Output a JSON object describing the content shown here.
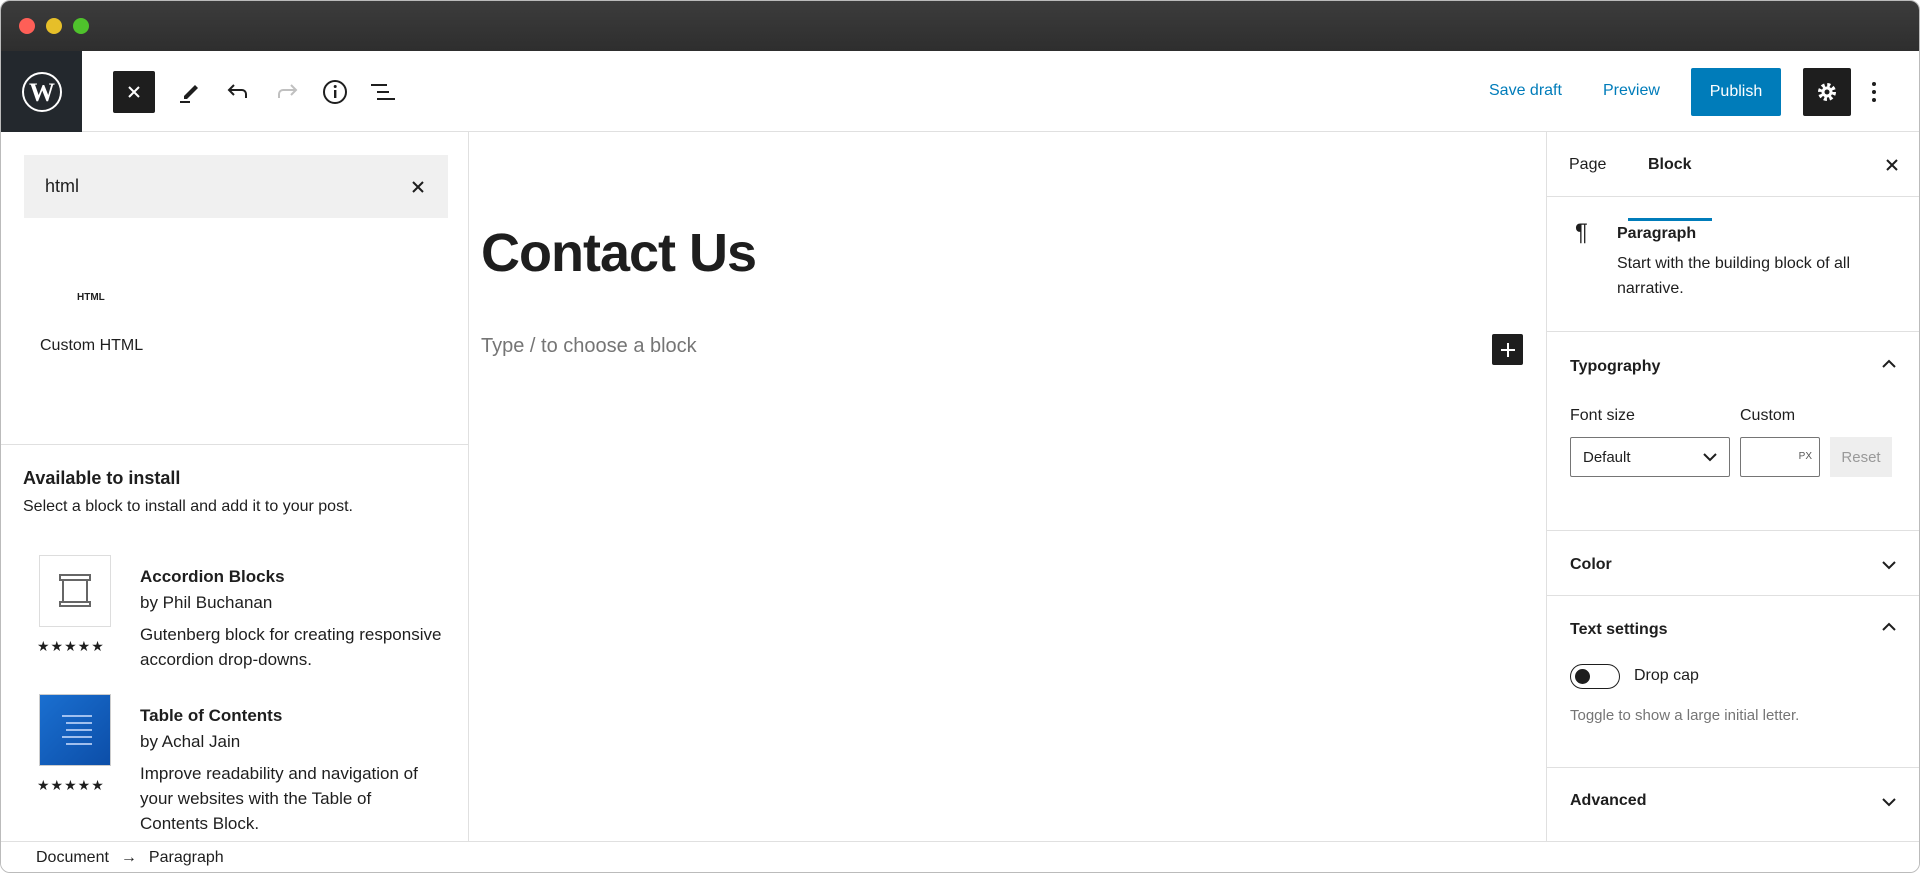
{
  "toolbar": {
    "save_draft": "Save draft",
    "preview": "Preview",
    "publish": "Publish"
  },
  "inserter": {
    "search_value": "html",
    "result_icon_text": "HTML",
    "result_label": "Custom HTML",
    "install_title": "Available to install",
    "install_desc": "Select a block to install and add it to your post.",
    "plugins": [
      {
        "title": "Accordion Blocks",
        "author": "by Phil Buchanan",
        "desc": "Gutenberg block for creating responsive accordion drop-downs.",
        "rating": 5,
        "stars": "★★★★★"
      },
      {
        "title": "Table of Contents",
        "author": "by Achal Jain",
        "desc": "Improve readability and navigation of your websites with the Table of Contents Block.",
        "rating": 5,
        "stars": "★★★★★"
      }
    ]
  },
  "editor": {
    "title": "Contact Us",
    "placeholder": "Type / to choose a block"
  },
  "sidebar": {
    "tabs": [
      "Page",
      "Block"
    ],
    "active_tab": "Block",
    "block_name": "Paragraph",
    "block_desc": "Start with the building block of all narrative.",
    "typography": "Typography",
    "font_size_label": "Font size",
    "font_size_value": "Default",
    "custom_label": "Custom",
    "custom_unit": "PX",
    "reset": "Reset",
    "color": "Color",
    "text_settings": "Text settings",
    "drop_cap": "Drop cap",
    "drop_cap_help": "Toggle to show a large initial letter.",
    "drop_cap_on": false,
    "advanced": "Advanced"
  },
  "breadcrumb": [
    "Document",
    "Paragraph"
  ],
  "colors": {
    "accent": "#007cba",
    "dark": "#1e1e1e"
  }
}
